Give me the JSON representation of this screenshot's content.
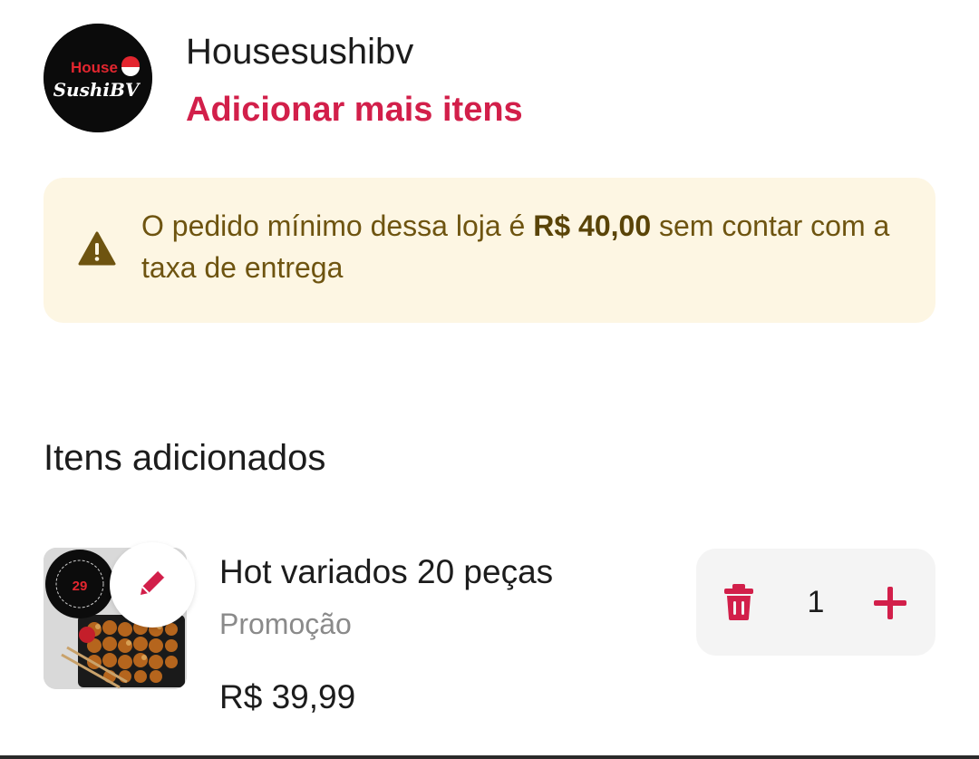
{
  "store": {
    "name": "Housesushibv",
    "add_more_label": "Adicionar mais itens",
    "logo": {
      "line1": "House",
      "line2": "SushiBV"
    }
  },
  "banner": {
    "icon": "warning-icon",
    "text_before": "O pedido mínimo dessa loja é ",
    "amount": "R$ 40,00",
    "text_after": " sem contar com a taxa de entrega"
  },
  "section": {
    "title": "Itens adicionados"
  },
  "items": [
    {
      "name": "Hot variados 20 peças",
      "subtitle": "Promoção",
      "price": "R$ 39,99",
      "quantity": "1",
      "thumbnail": {
        "badge": "29",
        "ring_text": "20 HOT ROLL VARIADOS"
      },
      "icons": {
        "edit": "pencil-icon",
        "delete": "trash-icon",
        "increment": "plus-icon"
      }
    }
  ],
  "colors": {
    "accent": "#d21f4a",
    "banner_bg": "#fdf6e3",
    "banner_text": "#6e5410",
    "qty_bg": "#f4f4f4"
  }
}
